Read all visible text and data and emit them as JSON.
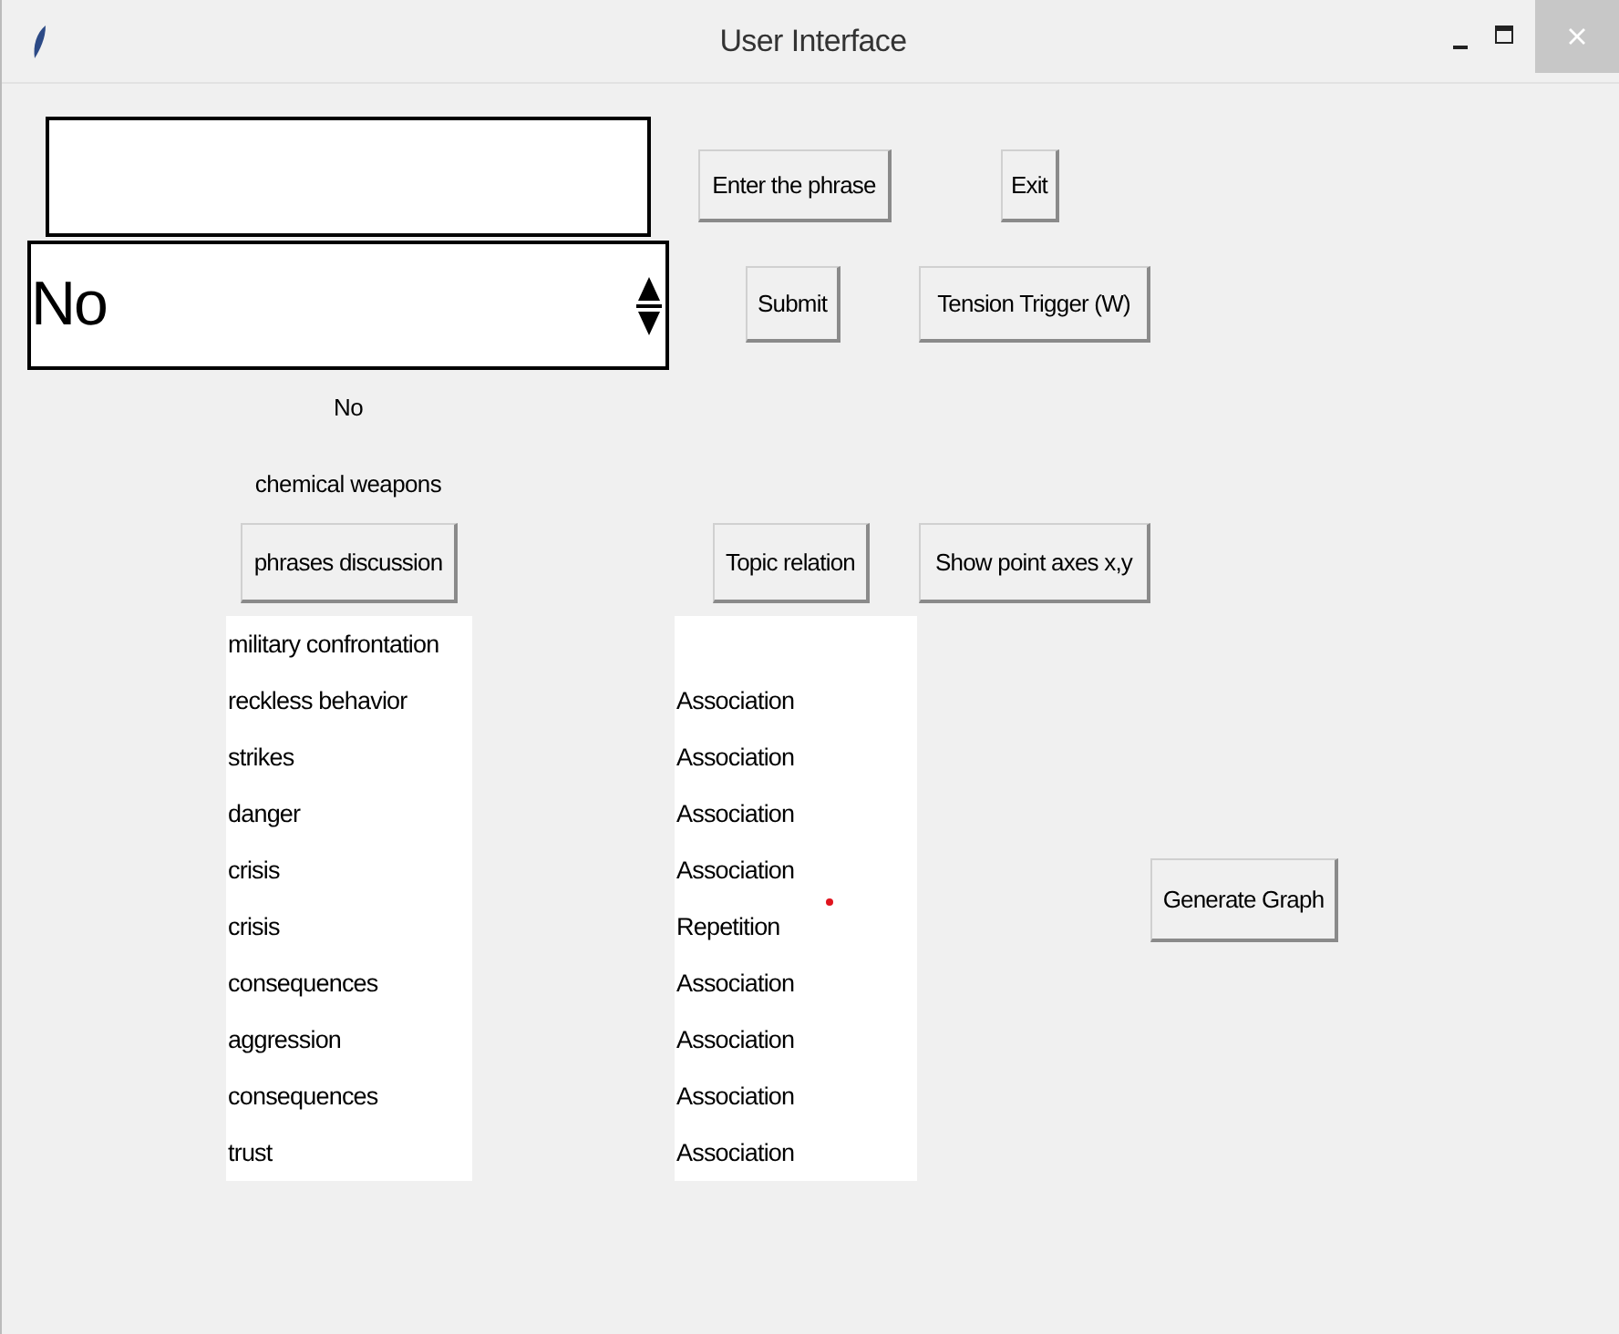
{
  "window": {
    "title": "User Interface"
  },
  "spinbox": {
    "value": "No"
  },
  "top_buttons": [
    "Enter the phrase",
    "Exit"
  ],
  "second_buttons": [
    "Submit",
    "Tension Trigger (W)"
  ],
  "labels": [
    "No",
    "chemical weapons"
  ],
  "third_buttons": [
    "phrases discussion",
    "Topic relation",
    "Show point axes x,y"
  ],
  "phrases_list": [
    "military confrontation",
    "reckless behavior",
    "strikes",
    "danger",
    "crisis",
    "crisis",
    "consequences",
    "aggression",
    "consequences",
    "trust"
  ],
  "relation_list": [
    "Association",
    "Association",
    "Association",
    "Association",
    "Repetition",
    "Association",
    "Association",
    "Association",
    "Association"
  ],
  "graph_button": "Generate Graph"
}
